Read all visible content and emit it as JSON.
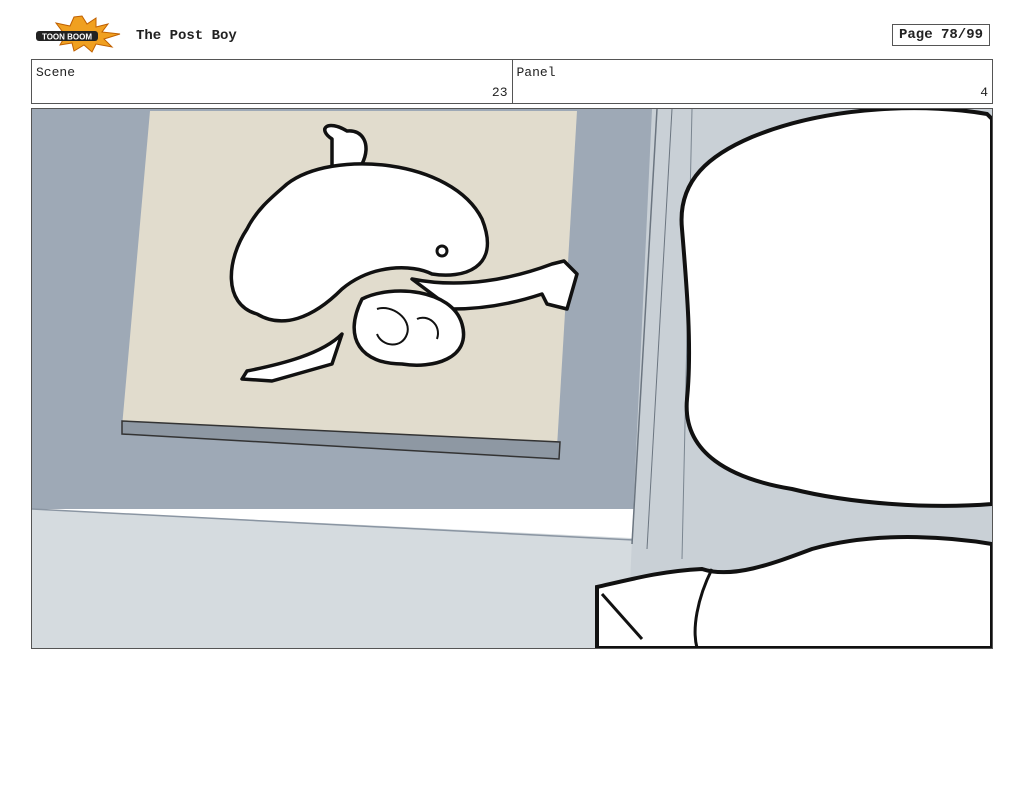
{
  "header": {
    "logo_text": "TOON BOOM",
    "title": "The Post Boy",
    "page_label": "Page 78/99"
  },
  "info": {
    "scene_label": "Scene",
    "scene_value": "23",
    "panel_label": "Panel",
    "panel_value": "4"
  },
  "colors": {
    "wall": "#9ea9b6",
    "poster": "#e1dccd",
    "floor": "#d5dbdf",
    "ink": "#111111",
    "logo_orange": "#f0a020"
  }
}
